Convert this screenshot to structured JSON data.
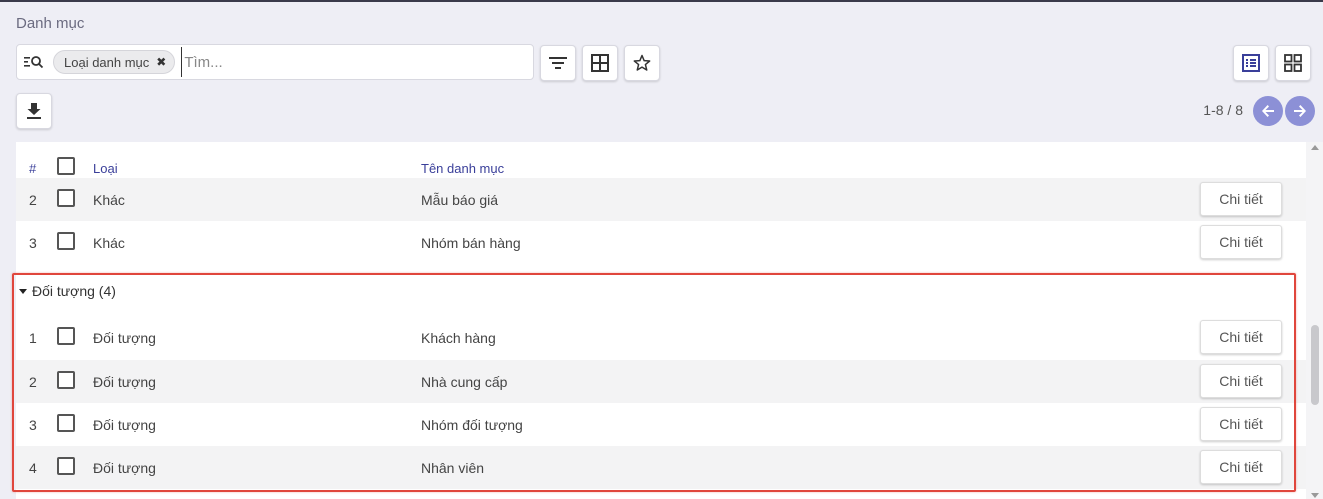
{
  "page": {
    "title": "Danh mục"
  },
  "search": {
    "chip_label": "Loại danh mục",
    "chip_remove": "✖",
    "placeholder": "Tìm...",
    "value": ""
  },
  "toolbar_icons": [
    "filter-icon",
    "group-by-icon",
    "favorite-star-icon",
    "list-view-icon",
    "kanban-view-icon",
    "download-icon"
  ],
  "pager": {
    "range": "1-8 / 8"
  },
  "table": {
    "columns": {
      "index": "#",
      "type": "Loại",
      "name": "Tên danh mục"
    },
    "detail_label": "Chi tiết",
    "top_rows": [
      {
        "index": "2",
        "type": "Khác",
        "name": "Mẫu báo giá"
      },
      {
        "index": "3",
        "type": "Khác",
        "name": "Nhóm bán hàng"
      }
    ],
    "group": {
      "label": "Đối tượng (4)",
      "rows": [
        {
          "index": "1",
          "type": "Đối tượng",
          "name": "Khách hàng"
        },
        {
          "index": "2",
          "type": "Đối tượng",
          "name": "Nhà cung cấp"
        },
        {
          "index": "3",
          "type": "Đối tượng",
          "name": "Nhóm đối tượng"
        },
        {
          "index": "4",
          "type": "Đối tượng",
          "name": "Nhân viên"
        }
      ]
    }
  },
  "colors": {
    "accent": "#3a3f9a",
    "nav": "#8c90d6",
    "highlight": "#e0463c"
  }
}
